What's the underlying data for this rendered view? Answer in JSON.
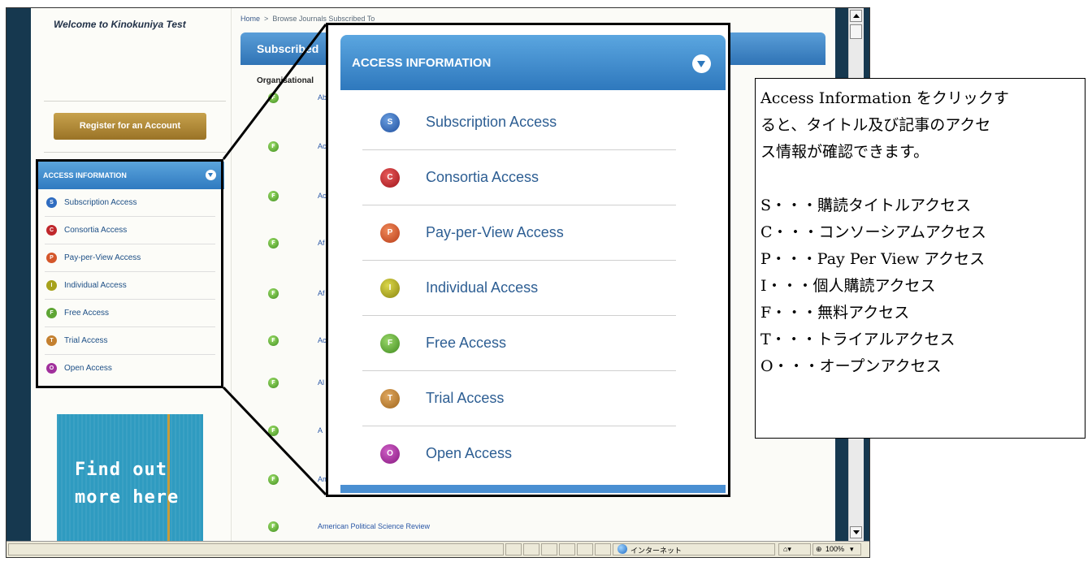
{
  "left": {
    "welcome": "Welcome to Kinokuniya Test",
    "register_label": "Register for an Account",
    "promo_line1": "Find out",
    "promo_line2": "more here"
  },
  "breadcrumb": {
    "home": "Home",
    "sep": ">",
    "current": "Browse Journals Subscribed To"
  },
  "main": {
    "heading": "Subscribed",
    "org_label": "Organisational",
    "journals": [
      "Ab",
      "Ac",
      "Ac",
      "Af",
      "Af",
      "Ac",
      "Al",
      "A",
      "Am",
      "American Political Science Review"
    ],
    "free_badge": "F"
  },
  "access_panel": {
    "title": "ACCESS INFORMATION",
    "items": [
      {
        "letter": "S",
        "label": "Subscription Access",
        "color": "#2f6cc0"
      },
      {
        "letter": "C",
        "label": "Consortia Access",
        "color": "#c0282c"
      },
      {
        "letter": "P",
        "label": "Pay-per-View Access",
        "color": "#d4562a"
      },
      {
        "letter": "I",
        "label": "Individual Access",
        "color": "#a7a21c"
      },
      {
        "letter": "F",
        "label": "Free Access",
        "color": "#5ea534"
      },
      {
        "letter": "T",
        "label": "Trial Access",
        "color": "#c4802f"
      },
      {
        "letter": "O",
        "label": "Open Access",
        "color": "#a1309c"
      }
    ]
  },
  "statusbar": {
    "zone": "インターネット",
    "zoom": "100%"
  },
  "note": {
    "line1": "Access Information をクリックす",
    "line2": "ると、タイトル及び記事のアクセ",
    "line3": "ス情報が確認できます。",
    "legend": [
      "S・・・購読タイトルアクセス",
      "C・・・コンソーシアムアクセス",
      "P・・・Pay Per View アクセス",
      "I・・・個人購読アクセス",
      "F・・・無料アクセス",
      "T・・・トライアルアクセス",
      "O・・・オープンアクセス"
    ]
  }
}
